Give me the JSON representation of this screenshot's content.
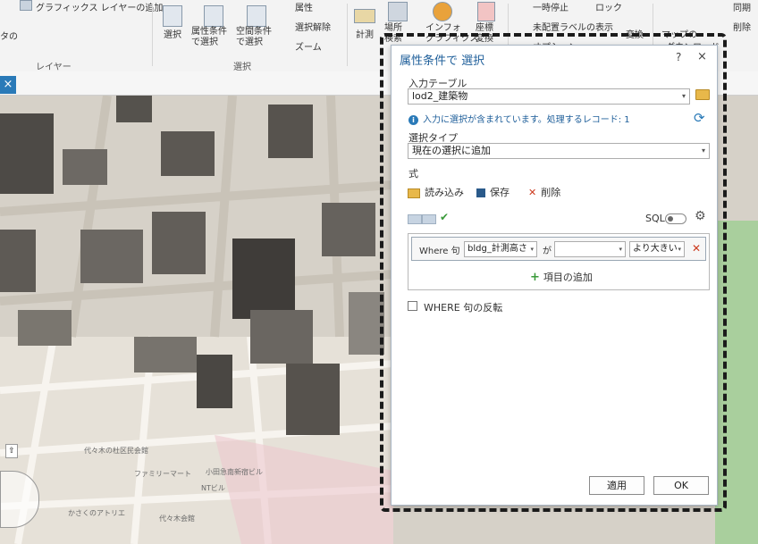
{
  "ribbon": {
    "add_graphics_layer": "グラフィックス レイヤーの追加",
    "data_label": "タの",
    "layer_group": "レイヤー",
    "select_label": "選択",
    "select_by_attr_label": "属性条件\nで選択",
    "select_by_loc_label": "空間条件\nで選択",
    "attributes_label": "属性",
    "clear_label": "選択解除",
    "zoom_label": "ズーム",
    "selection_group": "選択",
    "measure_label": "計測",
    "locate_label": "場所\n検索",
    "infographics_label": "インフォ\nグラフィクス",
    "coordinates_label": "座標\n変換",
    "pause_label": "一時停止",
    "lock_label": "ロック",
    "unplaced_labels_label": "未配置ラベルの表示",
    "options_label": "オプション",
    "convert_label": "変換",
    "map_label": "マップの",
    "download_label": "ダウンロード",
    "sync_label": "同期",
    "remove_label": "削除"
  },
  "dialog": {
    "title": "属性条件で 選択",
    "help": "?",
    "close": "×",
    "input_table_label": "入力テーブル",
    "input_table_value": "lod2_建築物",
    "info_text": "入力に選択が含まれています。処理するレコード: 1",
    "selection_type_label": "選択タイプ",
    "selection_type_value": "現在の選択に追加",
    "expression_label": "式",
    "load_label": "読み込み",
    "save_label": "保存",
    "delete_label": "削除",
    "sql_label": "SQL",
    "where_label": "Where 句",
    "field_value": "bldg_計測高さ",
    "ga_label": "が",
    "value_value": "",
    "operator_value": "より大きい",
    "add_clause_label": "項目の追加",
    "invert_where_label": "WHERE 句の反転",
    "apply_button": "適用",
    "ok_button": "OK"
  },
  "map": {
    "labels": [
      "代々木の杜区民会館",
      "小田急南新宿ビル",
      "NTビル",
      "かさくのアトリエ",
      "ファミリーマート",
      "代々木会館"
    ]
  },
  "colors": {
    "accent": "#2a7ab8",
    "title": "#1f5f9a",
    "delete_x": "#cc3a1e",
    "add_plus": "#3a9a3a"
  }
}
